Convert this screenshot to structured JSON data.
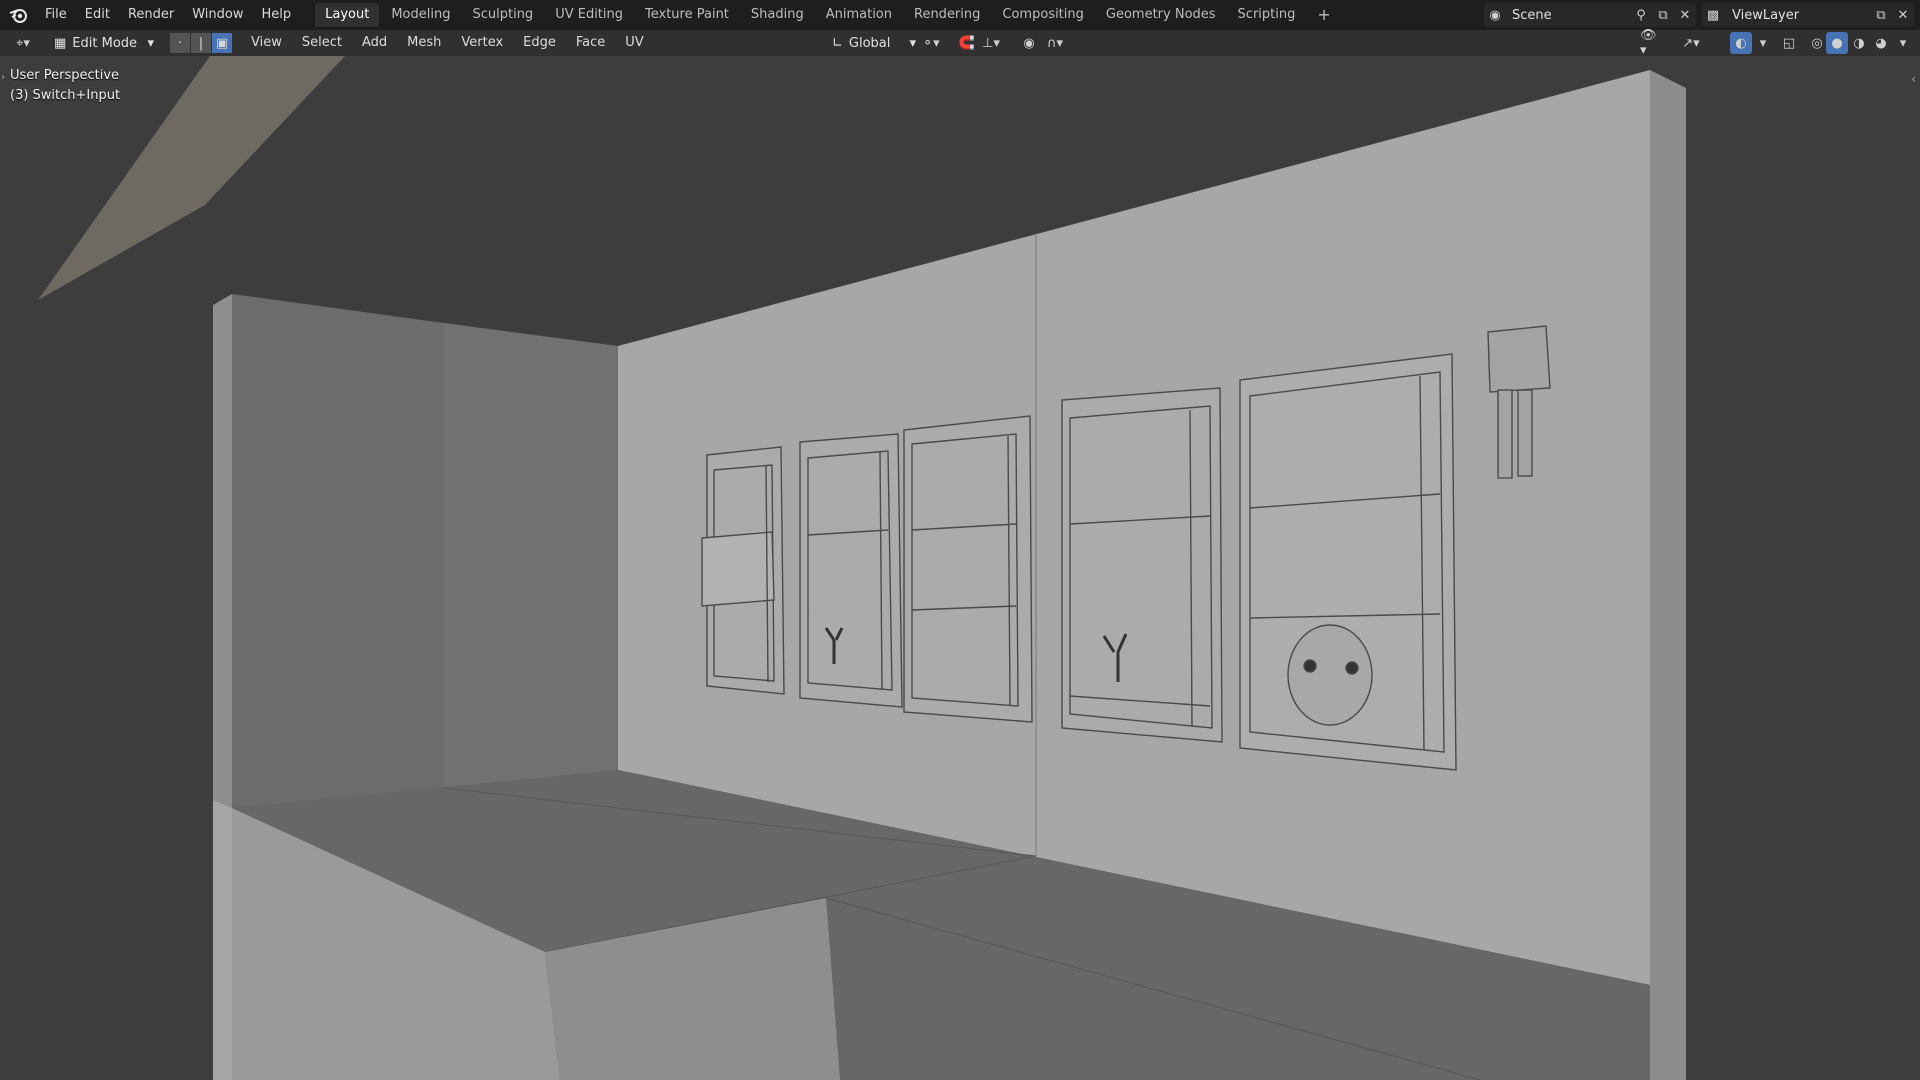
{
  "topbar": {
    "menus": [
      "File",
      "Edit",
      "Render",
      "Window",
      "Help"
    ],
    "workspaces": [
      "Layout",
      "Modeling",
      "Sculpting",
      "UV Editing",
      "Texture Paint",
      "Shading",
      "Animation",
      "Rendering",
      "Compositing",
      "Geometry Nodes",
      "Scripting"
    ],
    "active_workspace": "Layout",
    "add_tab": "+",
    "scene_name": "Scene",
    "view_layer_name": "ViewLayer"
  },
  "header": {
    "mode": "Edit Mode",
    "menus": [
      "View",
      "Select",
      "Add",
      "Mesh",
      "Vertex",
      "Edge",
      "Face",
      "UV"
    ],
    "transform_orientation": "Global"
  },
  "viewport": {
    "perspective_label": "User Perspective",
    "object_label": "(3) Switch+Input"
  },
  "colors": {
    "topbar_bg": "#1e1e1e",
    "header_bg": "#303030",
    "viewport_bg": "#3d3d3d",
    "accent": "#4772b3"
  }
}
